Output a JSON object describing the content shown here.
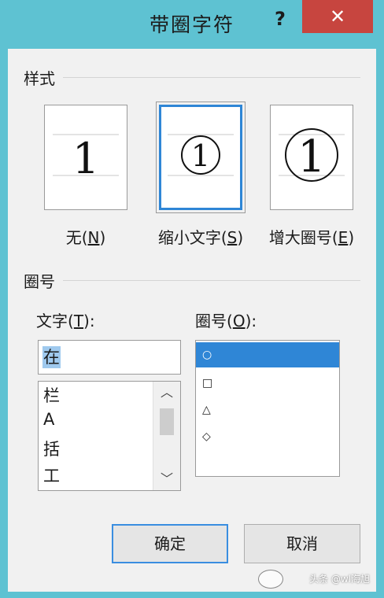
{
  "window": {
    "title": "带圈字符",
    "help_label": "?",
    "close_label": "✕"
  },
  "style_section": {
    "label": "样式",
    "preview_char": "1",
    "options": [
      {
        "label": "无",
        "hotkey": "N"
      },
      {
        "label": "缩小文字",
        "hotkey": "S"
      },
      {
        "label": "增大圈号",
        "hotkey": "E"
      }
    ],
    "selected_index": 1
  },
  "circle_section": {
    "label": "圈号",
    "text_field": {
      "label": "文字",
      "hotkey": "T",
      "suffix": ":",
      "value": "在",
      "list": [
        "栏",
        "A",
        "括",
        "工"
      ]
    },
    "circle_field": {
      "label": "圈号",
      "hotkey": "O",
      "suffix": ":",
      "options": [
        "○",
        "□",
        "△",
        "◇"
      ],
      "selected_index": 0
    }
  },
  "buttons": {
    "ok": "确定",
    "cancel": "取消"
  },
  "watermark": {
    "text": "头条 @wl海旭"
  },
  "colors": {
    "title_bar": "#5ec2d2",
    "close_button": "#c7453f",
    "selection": "#2f86d6"
  }
}
